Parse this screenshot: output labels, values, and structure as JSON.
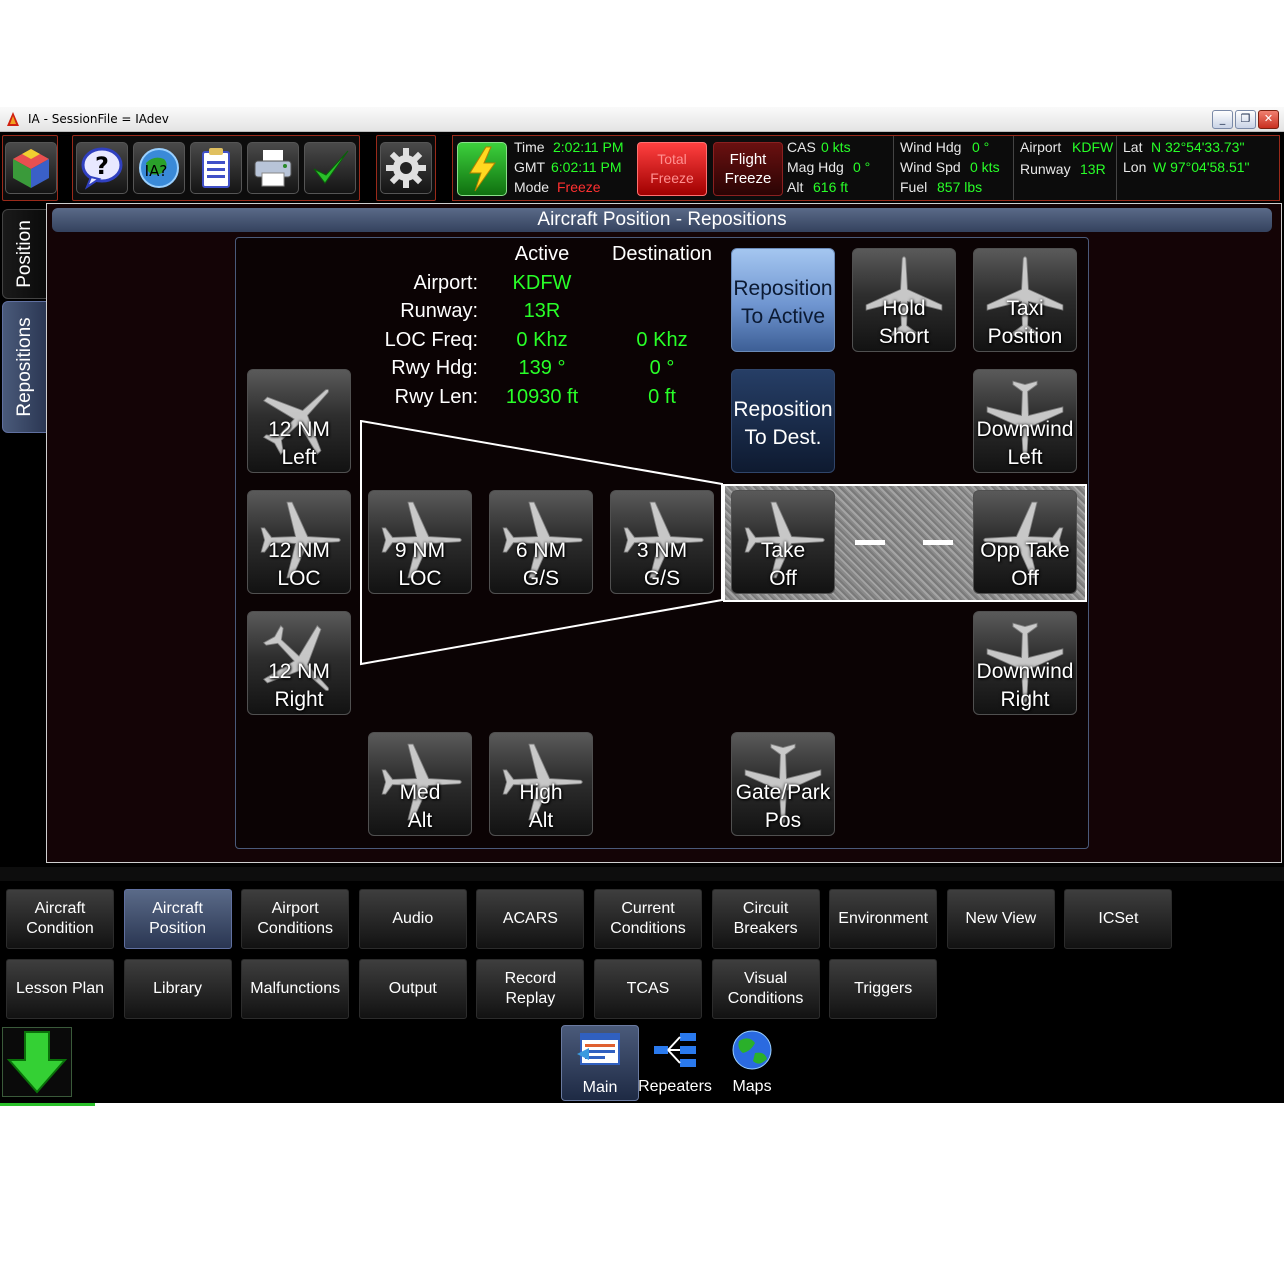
{
  "window": {
    "title": "IA - SessionFile = IAdev",
    "controls": [
      "_",
      "❐",
      "✕"
    ]
  },
  "toolbar": {
    "icons": [
      "app-cube-icon",
      "help-icon",
      "ia-help-icon",
      "clipboard-icon",
      "printer-icon",
      "checkmark-icon",
      "settings-gear-icon",
      "power-lightning-icon"
    ]
  },
  "status": {
    "time_label": "Time",
    "time_value": "2:02:11 PM",
    "gmt_label": "GMT",
    "gmt_value": "6:02:11 PM",
    "mode_label": "Mode",
    "mode_value": "Freeze",
    "total_freeze": "Total\nFreeze",
    "flight_freeze": "Flight\nFreeze",
    "cas_label": "CAS",
    "cas_value": "0 kts",
    "mag_hdg_label": "Mag Hdg",
    "mag_hdg_value": "0 °",
    "alt_label": "Alt",
    "alt_value": "616 ft",
    "wind_hdg_label": "Wind Hdg",
    "wind_hdg_value": "0 °",
    "wind_spd_label": "Wind Spd",
    "wind_spd_value": "0 kts",
    "fuel_label": "Fuel",
    "fuel_value": "857 lbs",
    "airport_label": "Airport",
    "airport_value": "KDFW",
    "runway_label": "Runway",
    "runway_value": "13R",
    "lat_label": "Lat",
    "lat_value": "N 32°54'33.73\"",
    "lon_label": "Lon",
    "lon_value": "W 97°04'58.51\""
  },
  "side_tabs": [
    "Position",
    "Repositions"
  ],
  "panel": {
    "title": "Aircraft Position - Repositions",
    "col_active": "Active",
    "col_destination": "Destination",
    "rows": [
      {
        "label": "Airport:",
        "active": "KDFW",
        "dest": ""
      },
      {
        "label": "Runway:",
        "active": "13R",
        "dest": ""
      },
      {
        "label": "LOC Freq:",
        "active": "0 Khz",
        "dest": "0 Khz"
      },
      {
        "label": "Rwy Hdg:",
        "active": "139 °",
        "dest": "0 °"
      },
      {
        "label": "Rwy Len:",
        "active": "10930 ft",
        "dest": "0 ft"
      }
    ],
    "buttons": {
      "reposition_active": [
        "Reposition",
        "To Active"
      ],
      "hold_short": [
        "Hold",
        "Short"
      ],
      "taxi_position": [
        "Taxi",
        "Position"
      ],
      "nm12_left": [
        "12 NM",
        "Left"
      ],
      "reposition_dest": [
        "Reposition",
        "To Dest."
      ],
      "downwind_left": [
        "Downwind",
        "Left"
      ],
      "nm12_loc": [
        "12 NM",
        "LOC"
      ],
      "nm9_loc": [
        "9 NM",
        "LOC"
      ],
      "nm6_gs": [
        "6 NM",
        "G/S"
      ],
      "nm3_gs": [
        "3 NM",
        "G/S"
      ],
      "take_off": [
        "Take",
        "Off"
      ],
      "opp_take_off": [
        "Opp Take",
        "Off"
      ],
      "nm12_right": [
        "12 NM",
        "Right"
      ],
      "downwind_right": [
        "Downwind",
        "Right"
      ],
      "med_alt": [
        "Med",
        "Alt"
      ],
      "high_alt": [
        "High",
        "Alt"
      ],
      "gate_park": [
        "Gate/Park",
        "Pos"
      ]
    }
  },
  "nav": {
    "row1": [
      "Aircraft\nCondition",
      "Aircraft\nPosition",
      "Airport\nConditions",
      "Audio",
      "ACARS",
      "Current\nConditions",
      "Circuit\nBreakers",
      "Environment",
      "New View",
      "ICSet"
    ],
    "row2": [
      "Lesson Plan",
      "Library",
      "Malfunctions",
      "Output",
      "Record\nReplay",
      "TCAS",
      "Visual\nConditions",
      "Triggers"
    ],
    "selected": "Aircraft\nPosition"
  },
  "dock": [
    "Main",
    "Repeaters",
    "Maps"
  ],
  "colors": {
    "accent_green": "#28ff28",
    "freeze_red": "#ff3030",
    "header_blue": "#4a5a7a"
  }
}
